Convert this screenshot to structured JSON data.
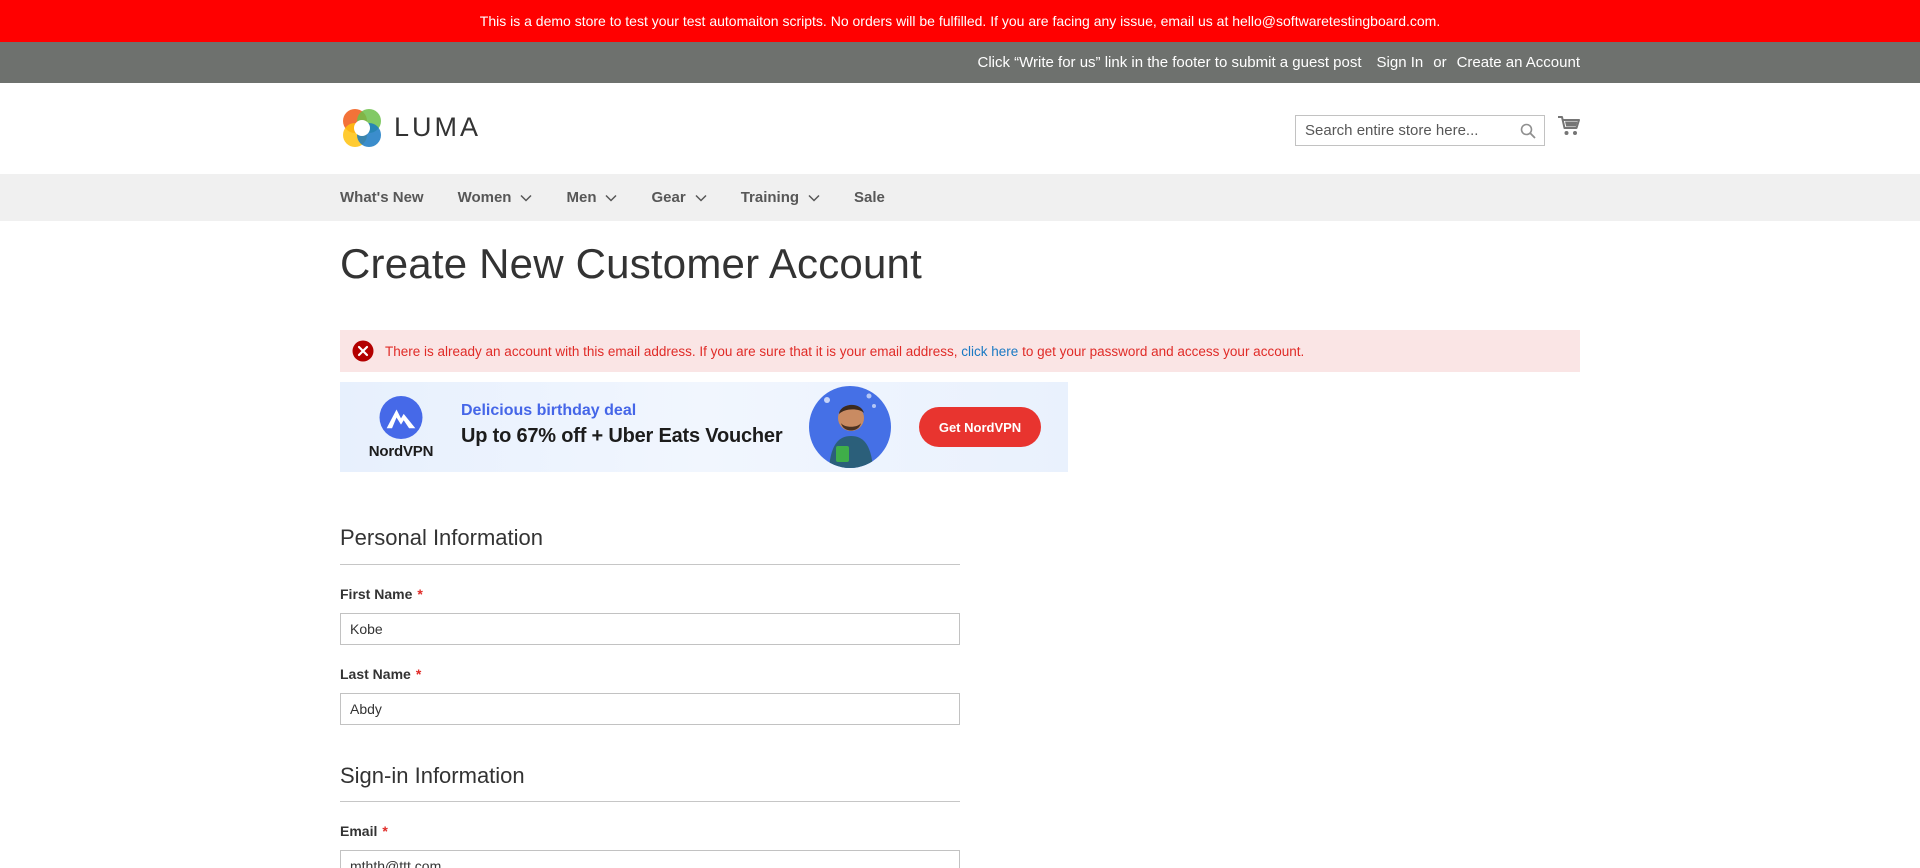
{
  "demo_banner": {
    "text": "This is a demo store to test your test automaiton scripts. No orders will be fulfilled. If you are facing any issue, email us at hello@softwaretestingboard.com."
  },
  "top_bar": {
    "guest_post": "Click “Write for us” link in the footer to submit a guest post",
    "sign_in": "Sign In",
    "or": "or",
    "create_account": "Create an Account"
  },
  "header": {
    "logo_text": "LUMA",
    "search_placeholder": "Search entire store here...",
    "search_value": ""
  },
  "nav": {
    "items": [
      {
        "label": "What's New",
        "has_dropdown": false
      },
      {
        "label": "Women",
        "has_dropdown": true
      },
      {
        "label": "Men",
        "has_dropdown": true
      },
      {
        "label": "Gear",
        "has_dropdown": true
      },
      {
        "label": "Training",
        "has_dropdown": true
      },
      {
        "label": "Sale",
        "has_dropdown": false
      }
    ]
  },
  "page": {
    "title": "Create New Customer Account"
  },
  "error": {
    "text_before": "There is already an account with this email address. If you are sure that it is your email address, ",
    "link": "click here",
    "text_after": " to get your password and access your account."
  },
  "ad": {
    "brand": "NordVPN",
    "kicker": "Delicious birthday deal",
    "headline": "Up to 67% off + Uber Eats Voucher",
    "cta": "Get NordVPN"
  },
  "form": {
    "personal_title": "Personal Information",
    "first_name_label": "First Name",
    "first_name_value": "Kobe",
    "last_name_label": "Last Name",
    "last_name_value": "Abdy",
    "signin_title": "Sign-in Information",
    "email_label": "Email",
    "email_value": "mthth@ttt.com",
    "required_mark": "*"
  },
  "colors": {
    "demo_banner": "#ff0000",
    "top_bar": "#6e716e",
    "nav_bg": "#f0f0f0",
    "error_bg": "#fae5e5",
    "error_text": "#e02b27",
    "link": "#1979c3",
    "ad_cta": "#e8342f"
  }
}
